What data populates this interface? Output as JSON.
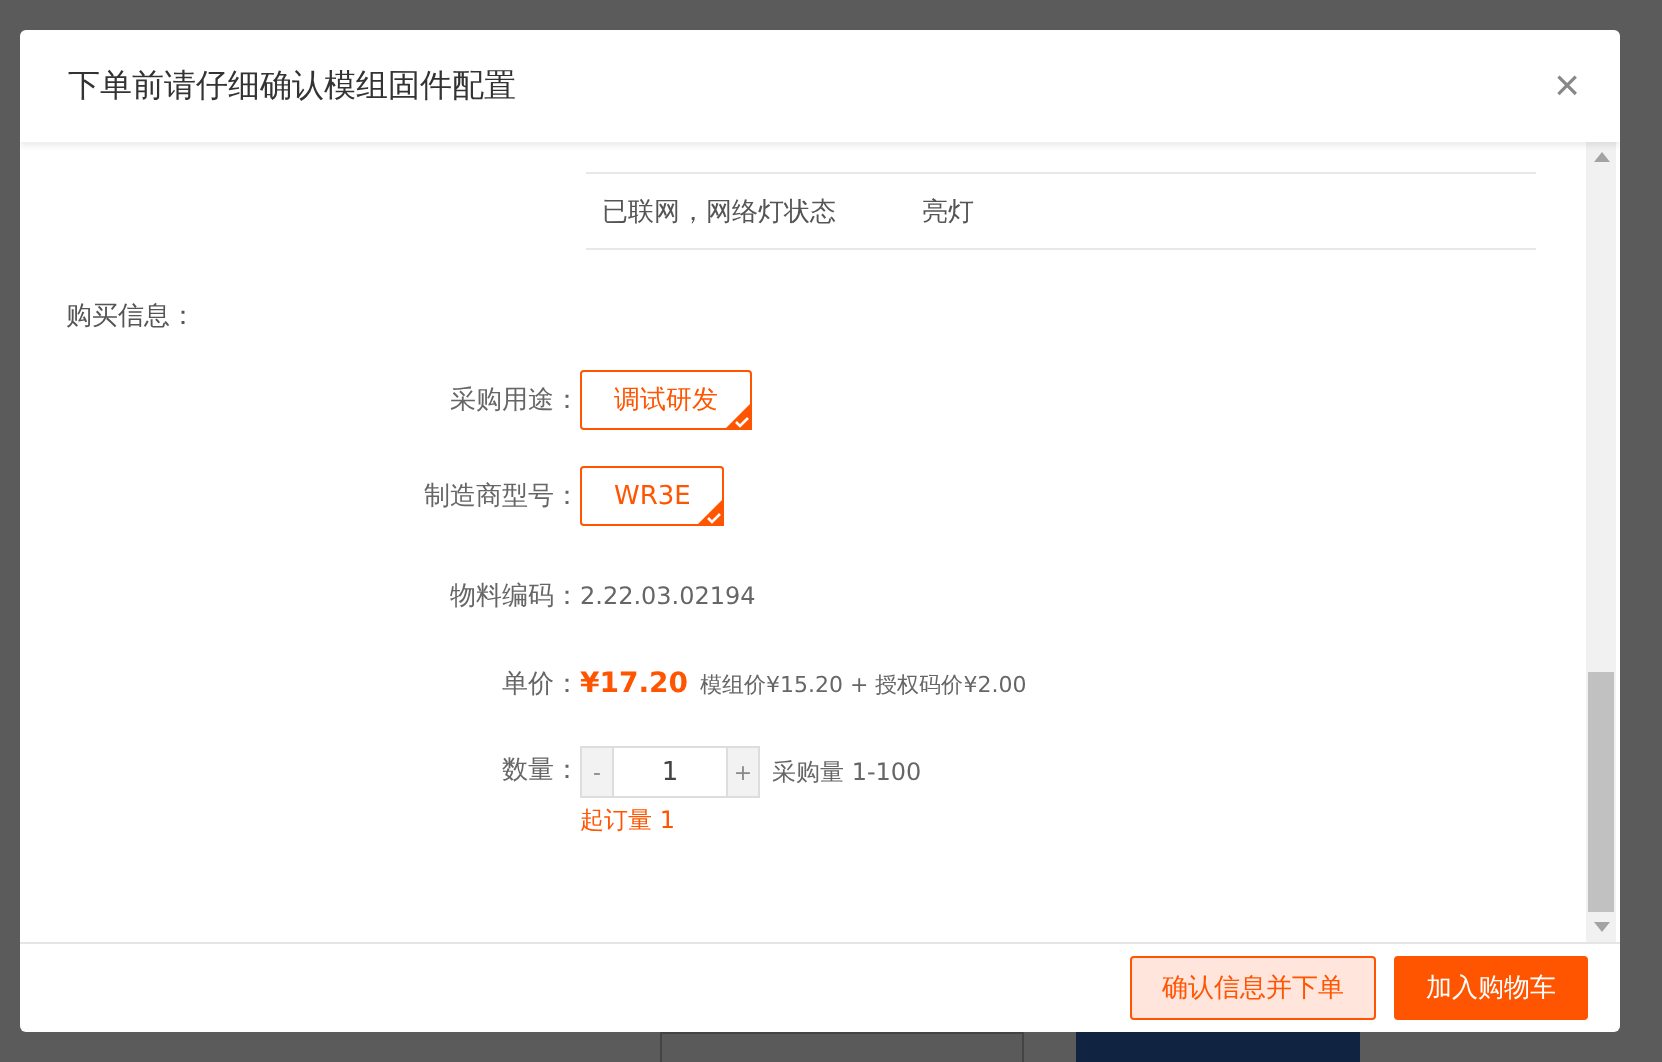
{
  "dialog": {
    "title": "下单前请仔细确认模组固件配置",
    "close": "×"
  },
  "config_table": {
    "rows": [
      {
        "name": "已联网，网络灯状态",
        "value": "亮灯"
      }
    ]
  },
  "section_title": "购买信息：",
  "fields": [
    {
      "kind": "options",
      "label": "采购用途：",
      "options": [
        {
          "label": "调试研发",
          "selected": true
        }
      ]
    },
    {
      "kind": "options",
      "label": "制造商型号：",
      "options": [
        {
          "label": "WR3E",
          "selected": true
        }
      ]
    },
    {
      "kind": "text",
      "label": "物料编码：",
      "value": "2.22.03.02194"
    },
    {
      "kind": "price",
      "label": "单价：",
      "price": "¥17.20",
      "detail": "模组价¥15.20 + 授权码价¥2.00"
    },
    {
      "kind": "quantity",
      "label": "数量：",
      "minus": "-",
      "value": "1",
      "plus": "+",
      "range": "采购量 1-100",
      "note": "起订量 1"
    }
  ],
  "buttons": [
    {
      "label": "确认信息并下单",
      "kind": "secondary"
    },
    {
      "label": "加入购物车",
      "kind": "primary"
    }
  ]
}
